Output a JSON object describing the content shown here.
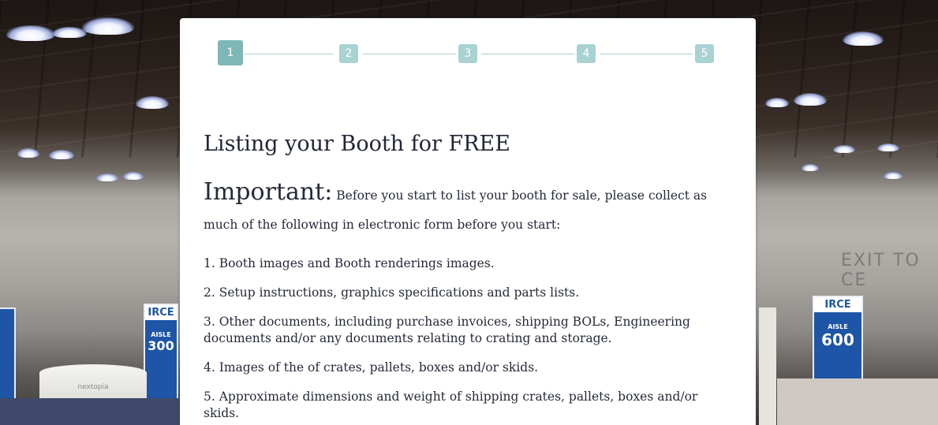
{
  "stepper": {
    "steps": [
      {
        "label": "1",
        "state": "active"
      },
      {
        "label": "2",
        "state": "inactive"
      },
      {
        "label": "3",
        "state": "inactive"
      },
      {
        "label": "4",
        "state": "inactive"
      },
      {
        "label": "5",
        "state": "inactive"
      }
    ],
    "colors": {
      "active": "#7fb6b6",
      "inactive": "#a9d2d2",
      "line": "#a9cfcf"
    }
  },
  "main": {
    "title": "Listing your Booth for FREE",
    "important_lead": "Important:",
    "important_text": "Before you start to list your booth for sale, please collect as much of the following in electronic form before you start:",
    "items": [
      "1.  Booth images and Booth renderings images.",
      "2.  Setup instructions, graphics specifications and parts lists.",
      "3.  Other documents, including purchase invoices, shipping BOLs, Engineering documents and/or any documents relating to crating and storage.",
      "4.  Images of the of crates, pallets, boxes and/or skids.",
      "5.  Approximate dimensions and weight of shipping crates, pallets, boxes and/or skids."
    ]
  },
  "background": {
    "wall_sign": "EXIT TO CE",
    "banners": [
      {
        "logo": "IRCE",
        "aisle": "AISLE",
        "number": "300"
      },
      {
        "logo": "IRCE",
        "aisle": "AISLE",
        "number": "600"
      }
    ],
    "drum_text": "nextopia"
  }
}
